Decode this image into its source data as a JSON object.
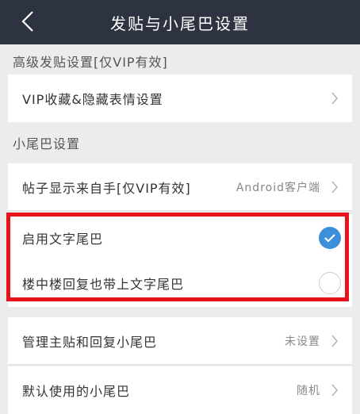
{
  "header": {
    "title": "发贴与小尾巴设置",
    "back_icon": "chevron-left-icon"
  },
  "sections": {
    "advanced": {
      "title": "高级发贴设置[仅VIP有效]"
    },
    "tail": {
      "title": "小尾巴设置"
    }
  },
  "rows": {
    "vip_collect": {
      "label": "VIP收藏&隐藏表情设置"
    },
    "post_source": {
      "label": "帖子显示来自手[仅VIP有效]",
      "value": "Android客户端"
    },
    "enable_text_tail": {
      "label": "启用文字尾巴",
      "checked": true
    },
    "floor_reply_tail": {
      "label": "楼中楼回复也带上文字尾巴",
      "checked": false
    },
    "manage_tail": {
      "label": "管理主贴和回复小尾巴",
      "value": "未设置"
    },
    "default_tail": {
      "label": "默认使用的小尾巴",
      "value": "随机"
    }
  },
  "colors": {
    "header_bg": "#2d3340",
    "accent": "#3d8fd9",
    "highlight": "#e8131b"
  }
}
